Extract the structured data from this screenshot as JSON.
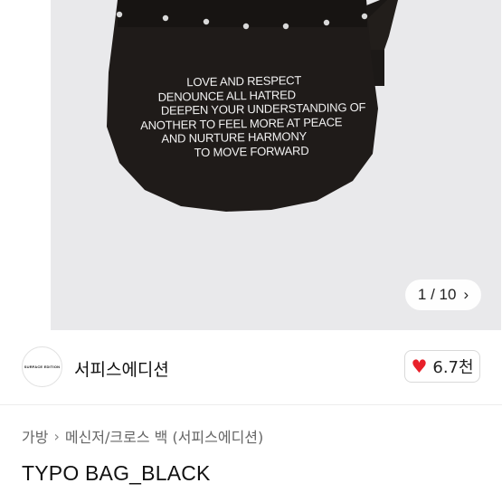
{
  "gallery": {
    "bag_text": {
      "line1": "LOVE AND RESPECT",
      "line2": "DENOUNCE ALL HATRED",
      "line3": "DEEPEN YOUR UNDERSTANDING OF",
      "line4": "ANOTHER TO FEEL MORE AT PEACE",
      "line5": "AND NURTURE HARMONY",
      "line6": "TO MOVE FORWARD"
    },
    "counter": {
      "text": "1 / 10",
      "icon": "chevron-right-icon"
    }
  },
  "seller": {
    "logo_text": "SURFACE EDITION",
    "name": "서피스에디션",
    "likes": {
      "icon": "heart-icon",
      "count": "6.7천",
      "color": "#e8202a"
    }
  },
  "breadcrumb": {
    "items": [
      "가방",
      "메신저/크로스 백 (서피스에디션)"
    ],
    "separator_icon": "chevron-right-icon"
  },
  "product": {
    "title": "TYPO BAG_BLACK"
  }
}
